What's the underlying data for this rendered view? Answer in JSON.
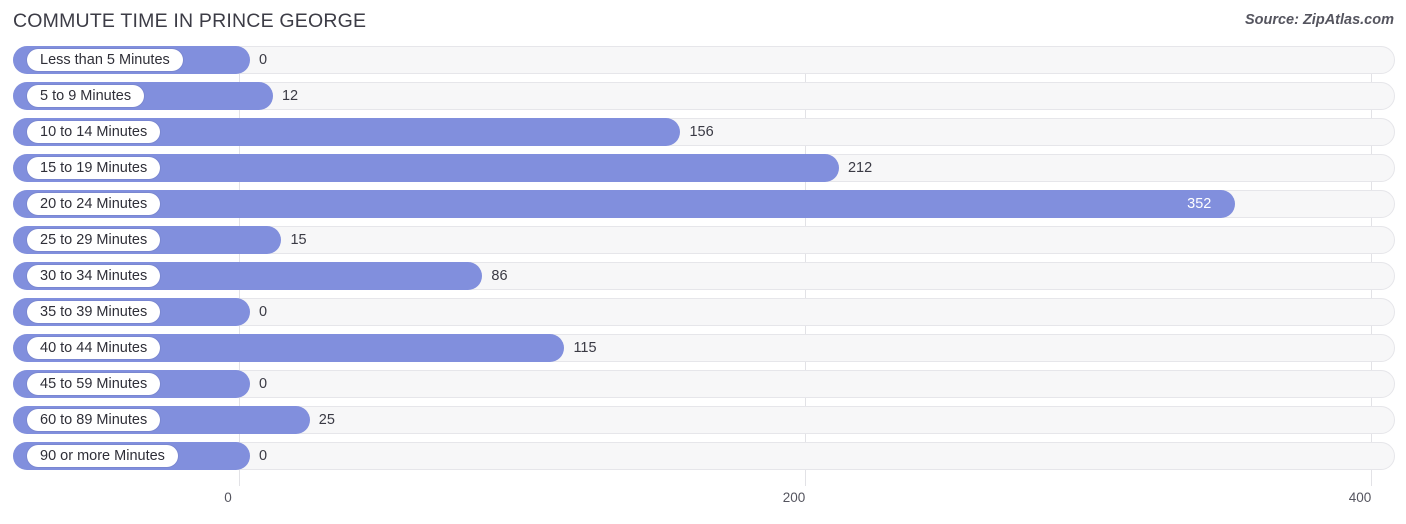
{
  "header": {
    "title": "COMMUTE TIME IN PRINCE GEORGE",
    "source": "Source: ZipAtlas.com"
  },
  "colors": {
    "bar": "#818fdd",
    "track": "#f7f7f8",
    "track_border": "#e6e6ea",
    "gridline": "#e2e2e6",
    "text": "#3a3a44",
    "value_inside": "#ffffff"
  },
  "chart_data": {
    "type": "bar",
    "orientation": "horizontal",
    "title": "COMMUTE TIME IN PRINCE GEORGE",
    "subtitle": "",
    "xlabel": "",
    "ylabel": "",
    "xlim": [
      0,
      400
    ],
    "grid": true,
    "legend": null,
    "xticks": [
      "0",
      "200",
      "400"
    ],
    "xtick_values": [
      0,
      200,
      400
    ],
    "categories": [
      "Less than 5 Minutes",
      "5 to 9 Minutes",
      "10 to 14 Minutes",
      "15 to 19 Minutes",
      "20 to 24 Minutes",
      "25 to 29 Minutes",
      "30 to 34 Minutes",
      "35 to 39 Minutes",
      "40 to 44 Minutes",
      "45 to 59 Minutes",
      "60 to 89 Minutes",
      "90 or more Minutes"
    ],
    "values": [
      0,
      12,
      156,
      212,
      352,
      15,
      86,
      0,
      115,
      0,
      25,
      0
    ],
    "value_labels": [
      "0",
      "12",
      "156",
      "212",
      "352",
      "15",
      "86",
      "0",
      "115",
      "0",
      "25",
      "0"
    ]
  }
}
